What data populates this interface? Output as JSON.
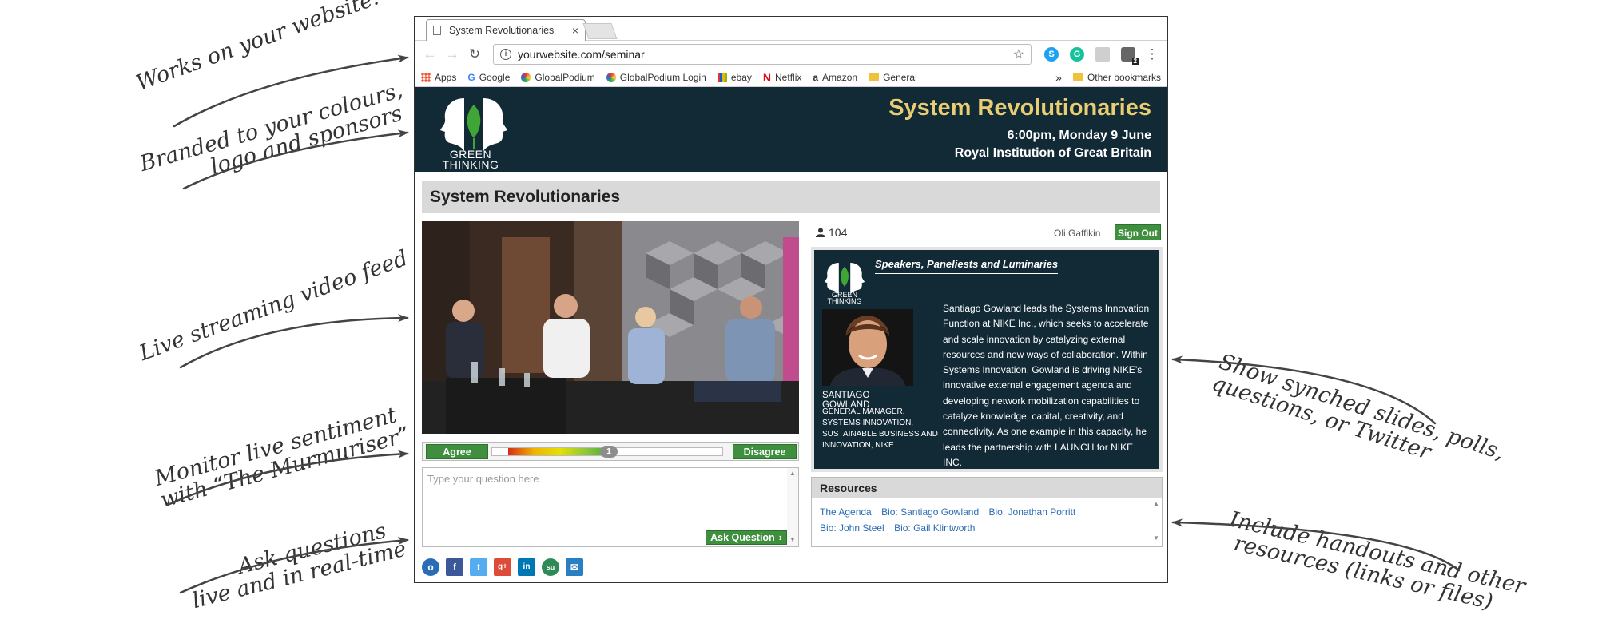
{
  "annotations": {
    "website": "Works on your website!",
    "branded_1": "Branded to your colours,",
    "branded_2": "logo and sponsors",
    "video": "Live streaming video feed",
    "sentiment_1": "Monitor live sentiment",
    "sentiment_2": "with “The Murmuriser”",
    "questions_1": "Ask questions",
    "questions_2": "live and in real-time",
    "slides_1": "Show synched slides, polls,",
    "slides_2": "questions, or Twitter",
    "handouts_1": "Include handouts and other",
    "handouts_2": "resources (links or files)"
  },
  "browser": {
    "tab_title": "System Revolutionaries",
    "tab_close": "×",
    "url": "yourwebsite.com/seminar",
    "bookmarks": [
      "Apps",
      "Google",
      "GlobalPodium",
      "GlobalPodium Login",
      "ebay",
      "Netflix",
      "Amazon",
      "General"
    ],
    "bookmarks_more": "»",
    "other_bookmarks": "Other bookmarks",
    "ext_badge": "2"
  },
  "banner": {
    "logo_text_1": "GREEN",
    "logo_text_2": "THINKING",
    "title": "System Revolutionaries",
    "date": "6:00pm, Monday 9 June",
    "venue": "Royal Institution of Great Britain"
  },
  "page_title": "System Revolutionaries",
  "sentiment": {
    "agree": "Agree",
    "disagree": "Disagree",
    "value": "1"
  },
  "question": {
    "placeholder": "Type your question here",
    "button": "Ask Question"
  },
  "viewers": "104",
  "user_name": "Oli Gaffikin",
  "sign_out": "Sign Out",
  "speakers": {
    "heading": "Speakers, Paneliests and Luminaries",
    "logo_text_1": "GREEN",
    "logo_text_2": "THINKING",
    "name": "SANTIAGO GOWLAND",
    "role": "GENERAL MANAGER, SYSTEMS INNOVATION, SUSTAINABLE BUSINESS AND INNOVATION, NIKE",
    "bio": "Santiago Gowland leads the Systems Innovation Function at NIKE Inc., which seeks to accelerate and scale innovation by catalyzing external resources and new ways of collaboration. Within Systems Innovation, Gowland is driving NIKE’s innovative external engagement agenda and developing network mobilization capabilities to catalyze knowledge, capital, creativity, and connectivity. As one example in this capacity, he leads the partnership with LAUNCH for NIKE INC."
  },
  "resources": {
    "heading": "Resources",
    "links": [
      "The Agenda",
      "Bio: Santiago Gowland",
      "Bio: Jonathan Porritt",
      "Bio: John Steel",
      "Bio: Gail Klintworth"
    ]
  },
  "colors": {
    "banner_bg": "#122a36",
    "banner_title": "#e8cd73",
    "accent_green": "#3e8f3e",
    "link_blue": "#2a6db5"
  }
}
